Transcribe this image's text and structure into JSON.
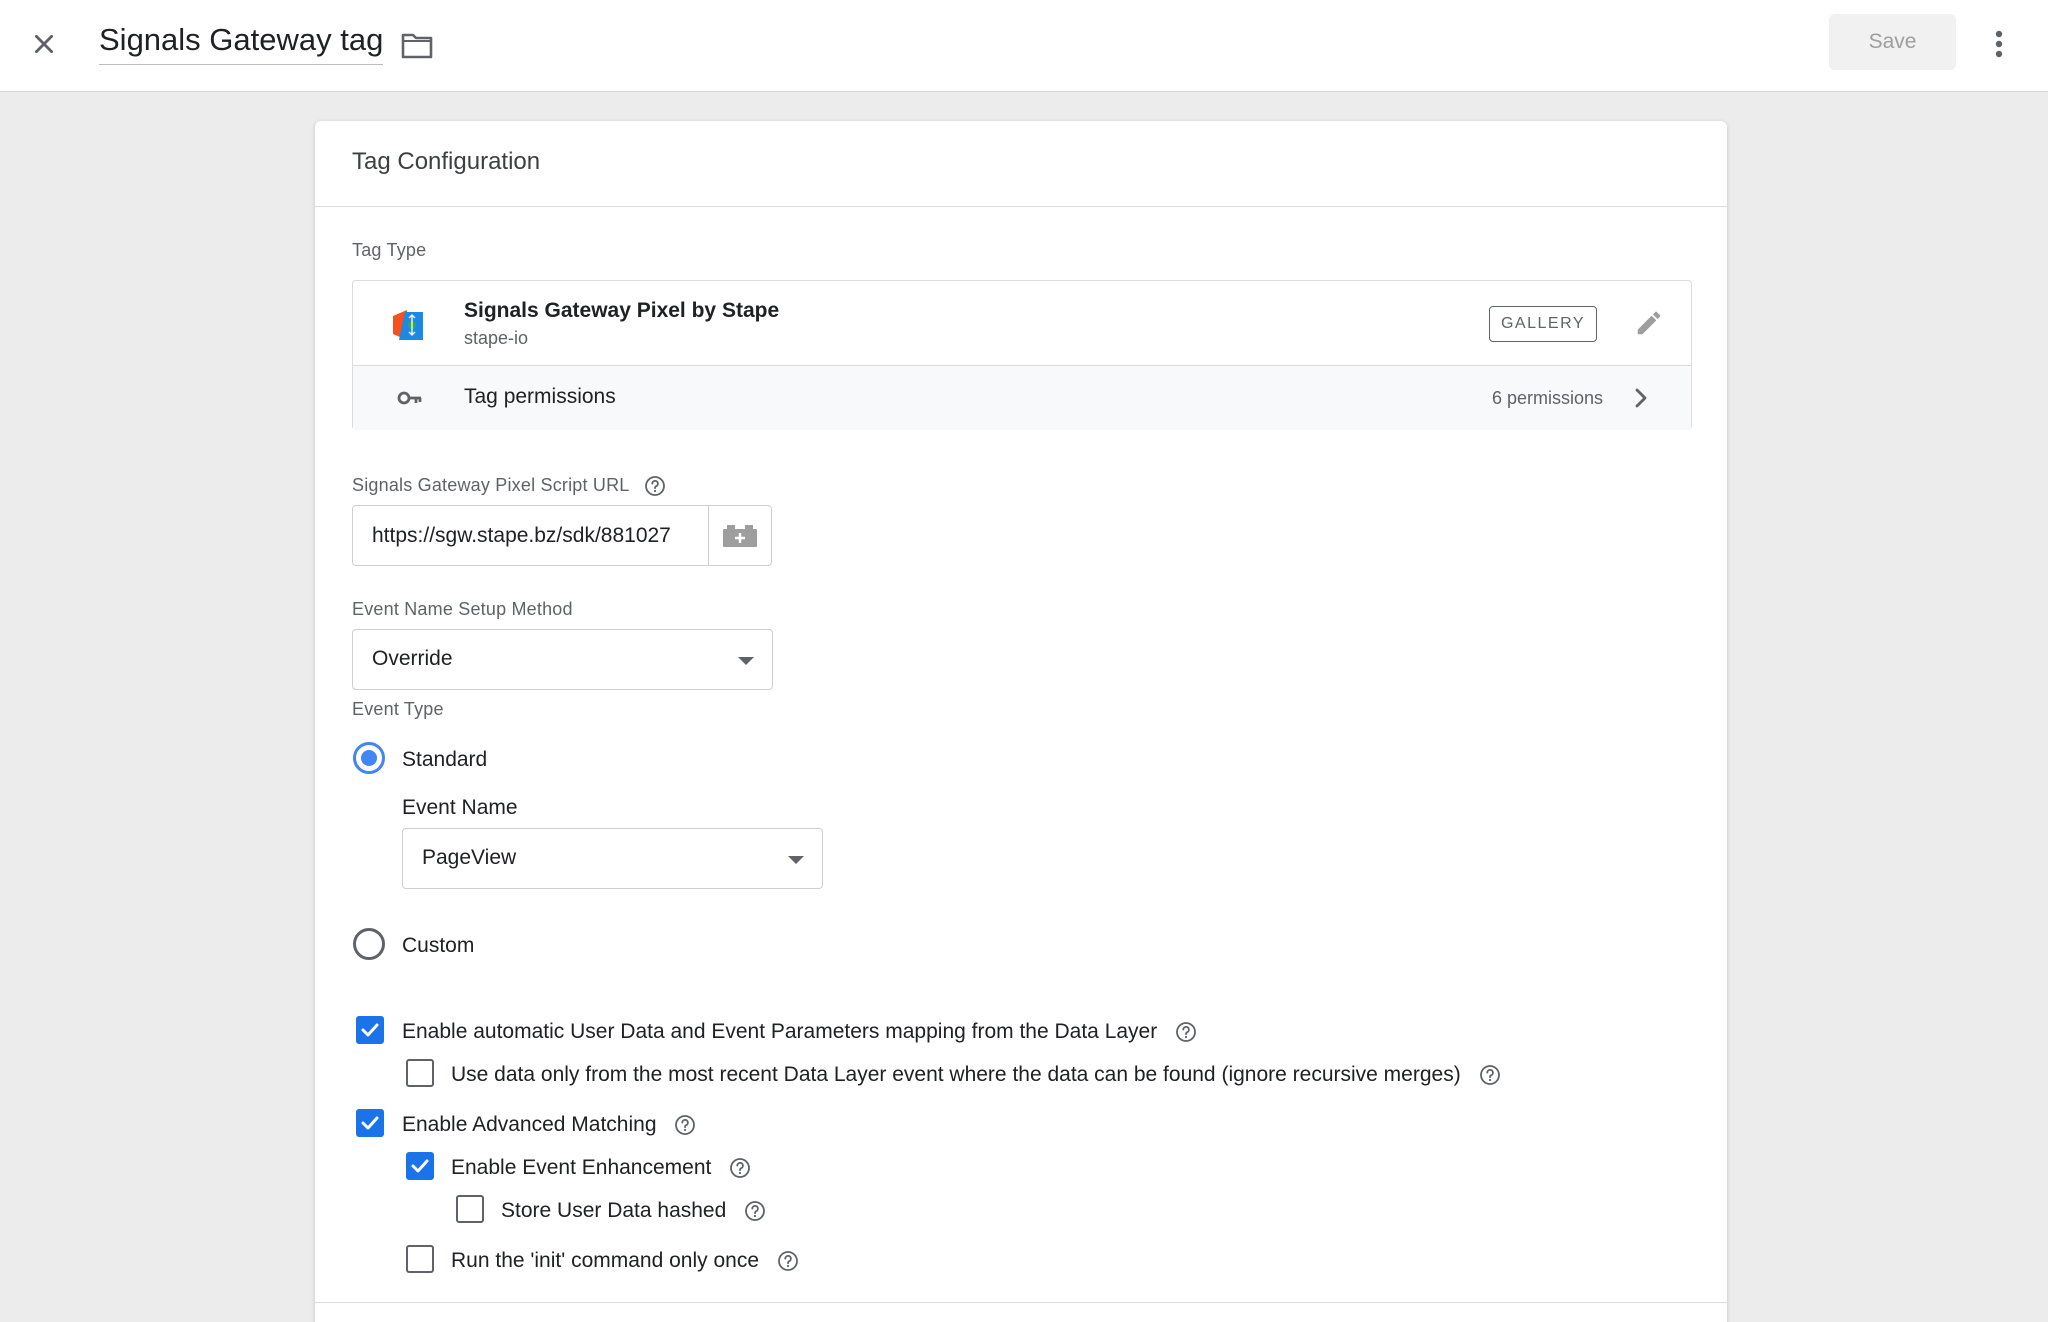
{
  "header": {
    "title": "Signals Gateway tag",
    "save_label": "Save"
  },
  "card": {
    "title": "Tag Configuration",
    "tag_type_label": "Tag Type",
    "tag": {
      "name": "Signals Gateway Pixel by Stape",
      "vendor": "stape-io",
      "badge": "GALLERY"
    },
    "permissions": {
      "label": "Tag permissions",
      "count": "6 permissions"
    }
  },
  "fields": {
    "script_url": {
      "label": "Signals Gateway Pixel Script URL",
      "value": "https://sgw.stape.bz/sdk/881027"
    },
    "event_name_setup": {
      "label": "Event Name Setup Method",
      "value": "Override"
    },
    "event_type": {
      "label": "Event Type",
      "options": [
        {
          "label": "Standard",
          "checked": true
        },
        {
          "label": "Custom",
          "checked": false
        }
      ],
      "event_name_label": "Event Name",
      "event_name_value": "PageView"
    }
  },
  "checkboxes": [
    {
      "label": "Enable automatic User Data and Event Parameters mapping from the Data Layer",
      "checked": true
    },
    {
      "label": "Use data only from the most recent Data Layer event where the data can be found (ignore recursive merges)",
      "checked": false
    },
    {
      "label": "Enable Advanced Matching",
      "checked": true
    },
    {
      "label": "Enable Event Enhancement",
      "checked": true
    },
    {
      "label": "Store User Data hashed",
      "checked": false
    },
    {
      "label": "Run the 'init' command only once",
      "checked": false
    }
  ],
  "colors": {
    "accent": "#1a73e8",
    "radio_accent": "#4285f4",
    "logo_orange": "#f4511e",
    "logo_blue": "#1e88e5"
  },
  "icons": [
    "close-icon",
    "folder-icon",
    "more-vert-icon",
    "edit-icon",
    "key-icon",
    "chevron-right-icon",
    "help-icon",
    "variable-icon",
    "dropdown-arrow-icon",
    "check-icon"
  ]
}
